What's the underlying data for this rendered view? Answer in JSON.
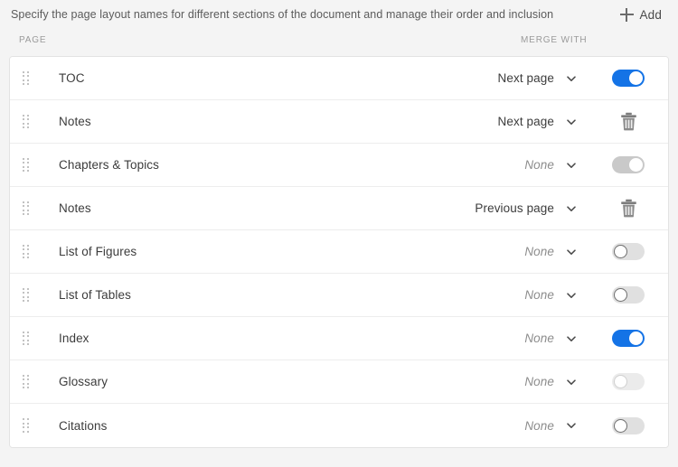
{
  "header": {
    "description": "Specify the page layout names for different sections of the document and manage their order and inclusion",
    "add_label": "Add",
    "add_icon": "plus-icon"
  },
  "columns": {
    "page": "PAGE",
    "merge_with": "MERGE WITH"
  },
  "icons": {
    "drag_handle": "drag-handle-icon",
    "chevron_down": "chevron-down-icon",
    "trash": "trash-icon"
  },
  "colors": {
    "accent_blue": "#1473e6",
    "track_off": "#e0e0e0",
    "track_disabled_on": "#c9c9c9",
    "track_disabled_off": "#ebebeb",
    "page_background": "#f4f4f4",
    "card_background": "#ffffff",
    "border": "#e3e3e3",
    "row_divider": "#ededed",
    "text_primary": "#3c3c3c",
    "text_muted": "#8d8d8d",
    "column_header": "#9a9a9a"
  },
  "rows": [
    {
      "page": "TOC",
      "merge_with": "Next page",
      "merge_is_none": false,
      "action": "toggle",
      "toggle_state": "on"
    },
    {
      "page": "Notes",
      "merge_with": "Next page",
      "merge_is_none": false,
      "action": "trash",
      "toggle_state": null
    },
    {
      "page": "Chapters & Topics",
      "merge_with": "None",
      "merge_is_none": true,
      "action": "toggle",
      "toggle_state": "on-disabled"
    },
    {
      "page": "Notes",
      "merge_with": "Previous page",
      "merge_is_none": false,
      "action": "trash",
      "toggle_state": null
    },
    {
      "page": "List of Figures",
      "merge_with": "None",
      "merge_is_none": true,
      "action": "toggle",
      "toggle_state": "off"
    },
    {
      "page": "List of Tables",
      "merge_with": "None",
      "merge_is_none": true,
      "action": "toggle",
      "toggle_state": "off"
    },
    {
      "page": "Index",
      "merge_with": "None",
      "merge_is_none": true,
      "action": "toggle",
      "toggle_state": "on"
    },
    {
      "page": "Glossary",
      "merge_with": "None",
      "merge_is_none": true,
      "action": "toggle",
      "toggle_state": "off-disabled"
    },
    {
      "page": "Citations",
      "merge_with": "None",
      "merge_is_none": true,
      "action": "toggle",
      "toggle_state": "off"
    }
  ]
}
